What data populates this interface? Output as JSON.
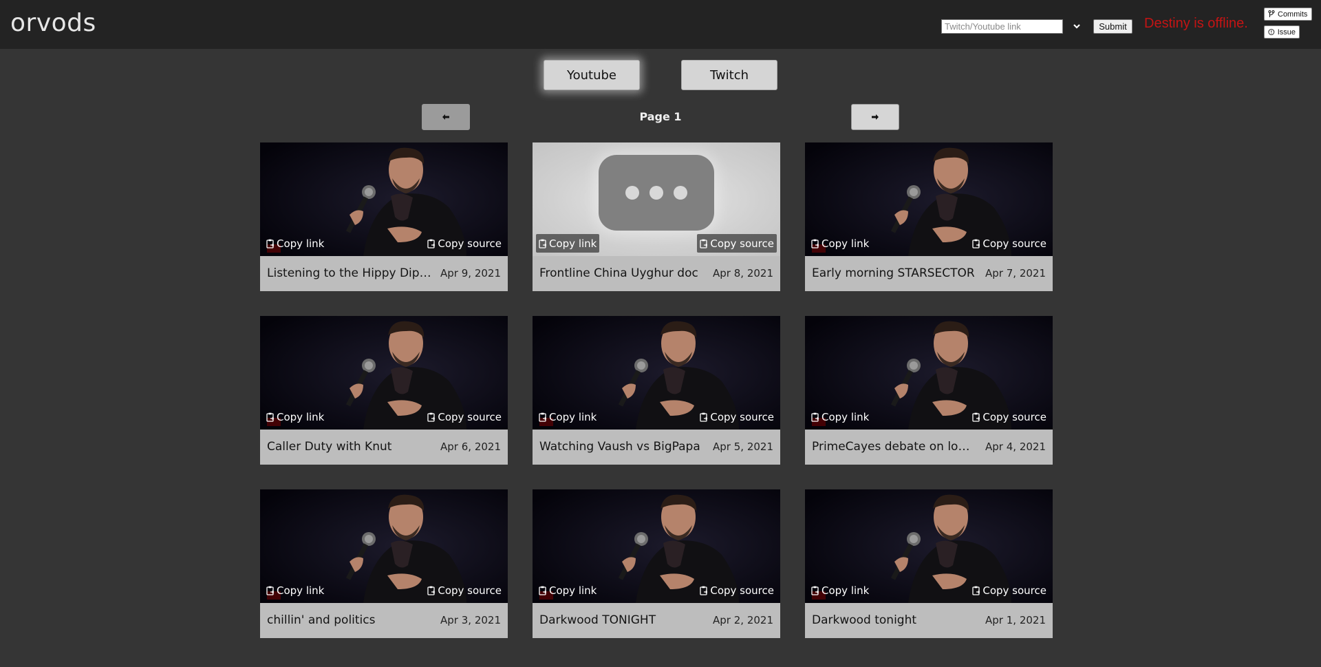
{
  "header": {
    "logo": "orvods",
    "link_placeholder": "Twitch/Youtube link",
    "submit_label": "Submit",
    "status_text": "Destiny is offline.",
    "commits_label": "Commits",
    "issue_label": "Issue",
    "status_color": "#c41414"
  },
  "tabs": [
    {
      "label": "Youtube",
      "active": true
    },
    {
      "label": "Twitch",
      "active": false
    }
  ],
  "pagination": {
    "prev_icon": "arrow-left-icon",
    "next_icon": "arrow-right-icon",
    "label": "Page 1"
  },
  "buttons": {
    "copy_link": "Copy link",
    "copy_source": "Copy source"
  },
  "vods": [
    {
      "title": "Listening to the Hippy Dippy Reddit",
      "date": "Apr 9, 2021",
      "thumbnail": "speaker-photo"
    },
    {
      "title": "Frontline China Uyghur doc",
      "date": "Apr 8, 2021",
      "thumbnail": "placeholder"
    },
    {
      "title": "Early morning STARSECTOR",
      "date": "Apr 7, 2021",
      "thumbnail": "speaker-photo"
    },
    {
      "title": "Caller Duty with Knut",
      "date": "Apr 6, 2021",
      "thumbnail": "speaker-photo"
    },
    {
      "title": "Watching Vaush vs BigPapa",
      "date": "Apr 5, 2021",
      "thumbnail": "speaker-photo"
    },
    {
      "title": "PrimeCayes debate on lobbying",
      "date": "Apr 4, 2021",
      "thumbnail": "speaker-photo"
    },
    {
      "title": "chillin' and politics",
      "date": "Apr 3, 2021",
      "thumbnail": "speaker-photo"
    },
    {
      "title": "Darkwood TONIGHT",
      "date": "Apr 2, 2021",
      "thumbnail": "speaker-photo"
    },
    {
      "title": "Darkwood tonight",
      "date": "Apr 1, 2021",
      "thumbnail": "speaker-photo"
    }
  ]
}
